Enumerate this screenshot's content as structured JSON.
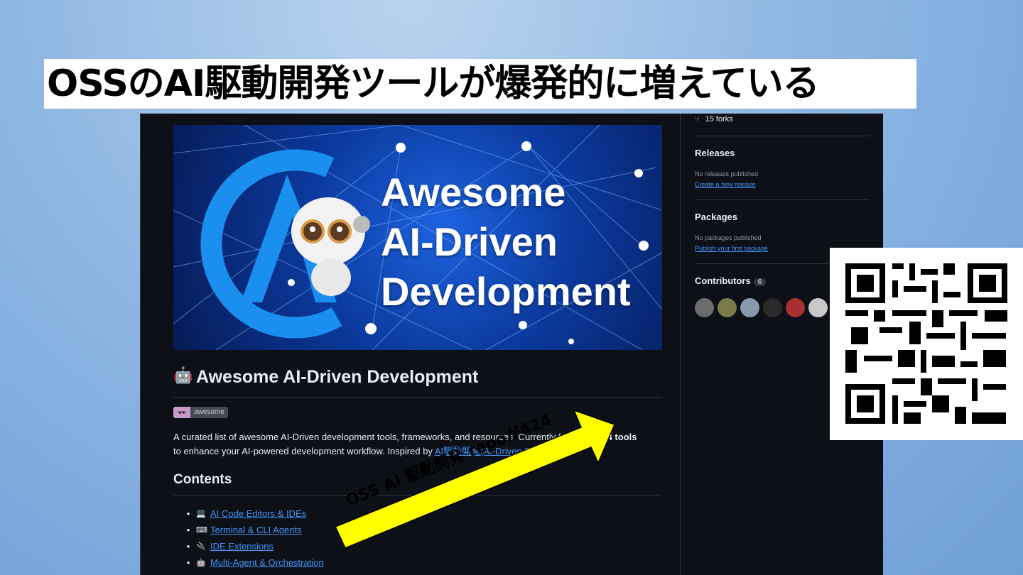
{
  "slide": {
    "title": "OSSのAI駆動開発ツールが爆発的に増えている"
  },
  "banner": {
    "line1": "Awesome",
    "line2": "AI-Driven",
    "line3": "Development"
  },
  "readme": {
    "heading": "Awesome AI-Driven Development",
    "heading_icon": "robot-icon",
    "badge_label": "awesome",
    "desc_part1": "A curated list of awesome AI-Driven development tools, frameworks, and resources. Currently f",
    "desc_hidden": "eaturing",
    "desc_bold": "424 tools",
    "desc_part2": "to enhance your AI-powered development workflow. Inspired by ",
    "desc_link": "AI駆動開発(AI-Driven D",
    "contents_heading": "Contents",
    "toc": [
      {
        "emoji": "💻",
        "label": "AI Code Editors & IDEs"
      },
      {
        "emoji": "⌨",
        "label": "Terminal & CLI Agents"
      },
      {
        "emoji": "🔌",
        "label": "IDE Extensions"
      },
      {
        "emoji": "🤖",
        "label": "Multi-Agent & Orchestration"
      }
    ]
  },
  "sidebar": {
    "forks": "15 forks",
    "releases_heading": "Releases",
    "releases_text": "No releases published",
    "releases_link": "Create a new release",
    "packages_heading": "Packages",
    "packages_text": "No packages published",
    "packages_link": "Publish your first package",
    "contributors_heading": "Contributors",
    "contributors_count": "6"
  },
  "callout": {
    "text": "OSS AI 駆動開発 repoが424",
    "color": "#ffff00"
  },
  "colors": {
    "bg": "#0d1117",
    "link": "#4493f8",
    "text": "#e6edf3"
  }
}
